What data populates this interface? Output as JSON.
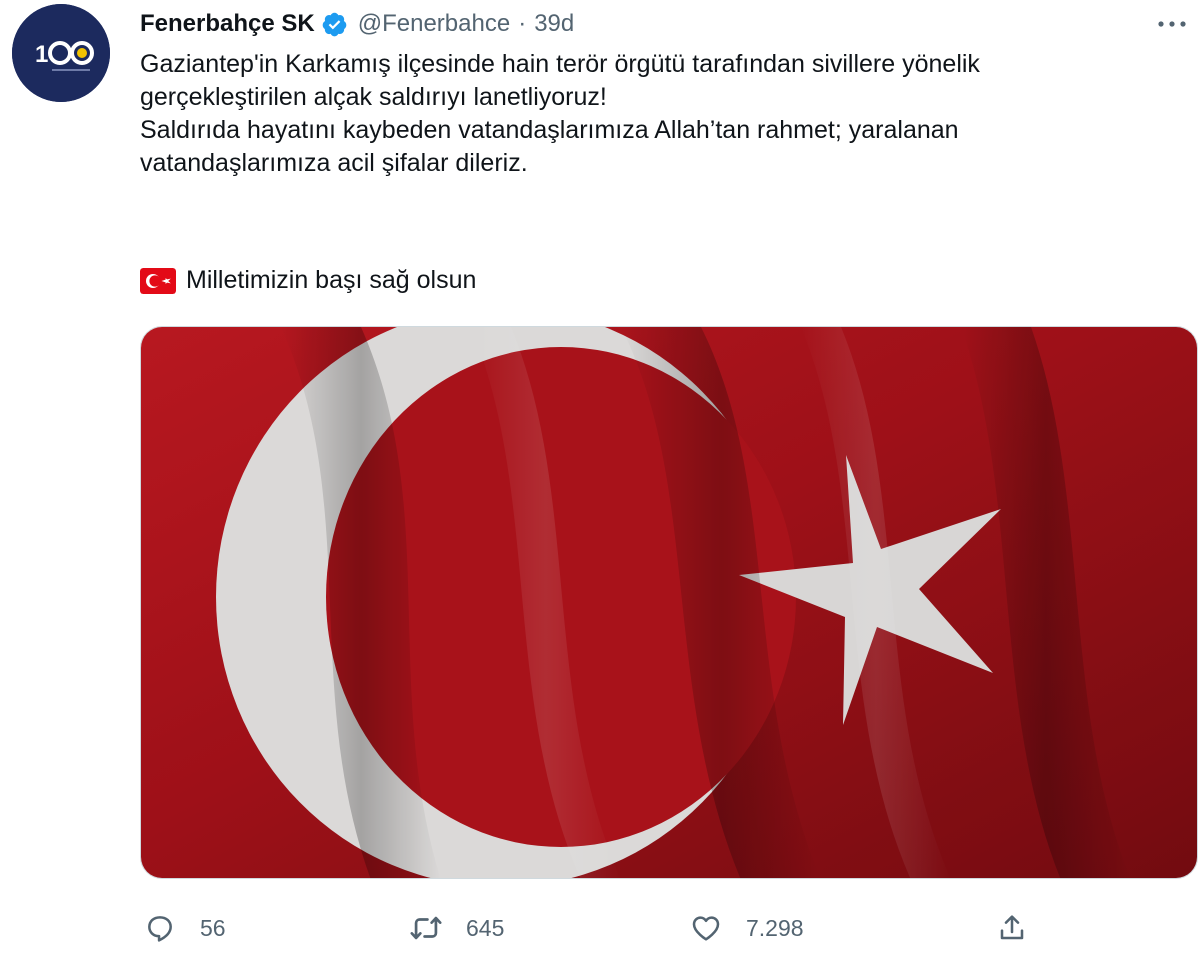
{
  "account": {
    "display_name": "Fenerbahçe SK",
    "handle": "@Fenerbahce",
    "separator": "·",
    "time": "39d",
    "avatar_text": "100"
  },
  "tweet": {
    "text": "Gaziantep'in Karkamış ilçesinde hain terör örgütü tarafından sivillere yönelik\ngerçekleştirilen alçak saldırıyı lanetliyoruz!\nSaldırıda hayatını kaybeden vatandaşlarımıza Allah’tan rahmet; yaralanan\nvatandaşlarımıza acil şifalar dileriz.",
    "flag_line": "Milletimizin başı sağ olsun",
    "flag_emoji": "turkey-flag-icon"
  },
  "media": {
    "description_icon": "turkish-flag-image",
    "colors": {
      "red": "#b3141c",
      "white": "#ececec"
    }
  },
  "actions": {
    "reply_count": "56",
    "retweet_count": "645",
    "like_count": "7.298"
  },
  "colors": {
    "verified": "#1d9bf0",
    "secondary_text": "#536471",
    "avatar_bg": "#1c2a5e"
  }
}
